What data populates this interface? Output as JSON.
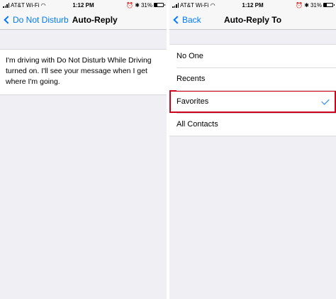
{
  "status_bar": {
    "carrier": "AT&T Wi-Fi",
    "time": "1:12 PM",
    "battery": "31%",
    "battery_level": 0.31
  },
  "left_screen": {
    "back_label": "Do Not Disturb",
    "title": "Auto-Reply",
    "message": "I'm driving with Do Not Disturb While Driving turned on. I'll see your message when I get where I'm going."
  },
  "right_screen": {
    "back_label": "Back",
    "title": "Auto-Reply To",
    "options": [
      {
        "label": "No One",
        "selected": false
      },
      {
        "label": "Recents",
        "selected": false
      },
      {
        "label": "Favorites",
        "selected": true
      },
      {
        "label": "All Contacts",
        "selected": false
      }
    ]
  },
  "colors": {
    "accent": "#007aff",
    "highlight_box": "#d0021b",
    "background": "#efeff4"
  }
}
